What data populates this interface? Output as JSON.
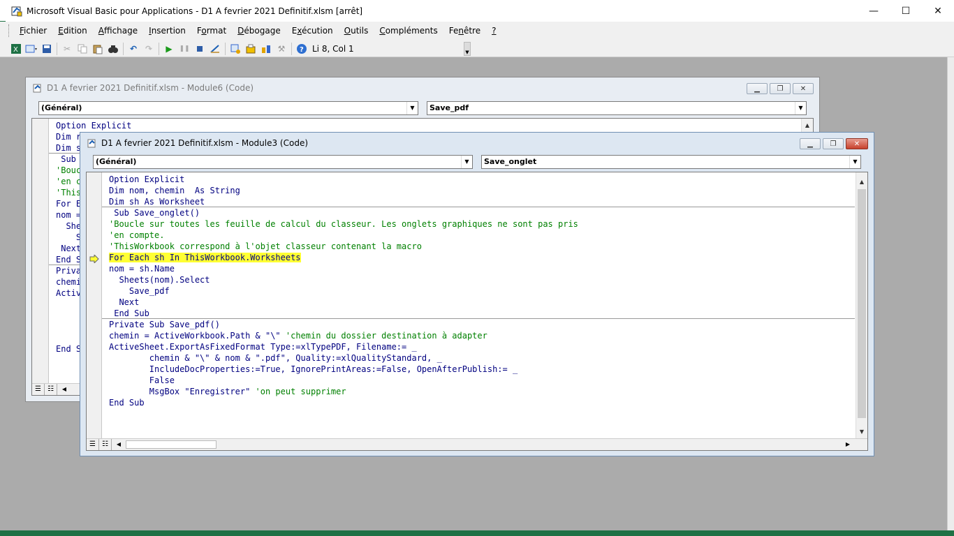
{
  "app": {
    "title": "Microsoft Visual Basic pour Applications - D1 A fevrier 2021 Definitif.xlsm [arrêt]",
    "controls": {
      "minimize": "—",
      "maximize": "☐",
      "close": "✕"
    }
  },
  "menu": [
    {
      "label": "Fichier",
      "ul": "F",
      "rest": "ichier"
    },
    {
      "label": "Edition",
      "ul": "E",
      "rest": "dition"
    },
    {
      "label": "Affichage",
      "ul": "A",
      "rest": "ffichage"
    },
    {
      "label": "Insertion",
      "ul": "I",
      "rest": "nsertion"
    },
    {
      "label": "Format",
      "ul": "o",
      "pre": "F",
      "rest": "rmat"
    },
    {
      "label": "Débogage",
      "ul": "D",
      "rest": "ébogage"
    },
    {
      "label": "Exécution",
      "ul": "x",
      "pre": "E",
      "rest": "écution"
    },
    {
      "label": "Outils",
      "ul": "O",
      "rest": "utils"
    },
    {
      "label": "Compléments",
      "ul": "C",
      "rest": "ompléments"
    },
    {
      "label": "Fenêtre",
      "ul": "n",
      "pre": "Fe",
      "rest": "être"
    },
    {
      "label": "?",
      "ul": "?",
      "rest": ""
    }
  ],
  "toolbar": {
    "cursor_position": "Li 8, Col 1"
  },
  "window_back": {
    "title": "D1 A fevrier 2021 Definitif.xlsm - Module6 (Code)",
    "object_combo": "(Général)",
    "proc_combo": "Save_pdf",
    "lines": [
      {
        "t": "Option Explicit",
        "c": ""
      },
      {
        "t": "Dim r",
        "c": ""
      },
      {
        "t": "Dim s",
        "c": ""
      },
      {
        "t": " Sub ",
        "c": ""
      },
      {
        "t": "",
        "c": "'Bouc"
      },
      {
        "t": "",
        "c": "'en c"
      },
      {
        "t": "",
        "c": "'This"
      },
      {
        "t": "For E",
        "c": ""
      },
      {
        "t": "nom =",
        "c": ""
      },
      {
        "t": "  She",
        "c": ""
      },
      {
        "t": "    S",
        "c": ""
      },
      {
        "t": " Next",
        "c": ""
      },
      {
        "t": "End S",
        "c": ""
      },
      {
        "t": "Priva",
        "c": ""
      },
      {
        "t": "chemi",
        "c": ""
      },
      {
        "t": "Activ",
        "c": ""
      },
      {
        "t": "",
        "c": ""
      },
      {
        "t": "",
        "c": ""
      },
      {
        "t": "",
        "c": ""
      },
      {
        "t": "",
        "c": ""
      },
      {
        "t": "End S",
        "c": ""
      }
    ]
  },
  "window_front": {
    "title": "D1 A fevrier 2021 Definitif.xlsm - Module3 (Code)",
    "object_combo": "(Général)",
    "proc_combo": "Save_onglet",
    "lines": [
      {
        "t": "Option Explicit",
        "c": ""
      },
      {
        "t": "Dim nom, chemin  As String",
        "c": ""
      },
      {
        "t": "Dim sh As Worksheet",
        "c": ""
      },
      {
        "t": " Sub Save_onglet()",
        "c": ""
      },
      {
        "t": "",
        "c": "'Boucle sur toutes les feuille de calcul du classeur. Les onglets graphiques ne sont pas pris"
      },
      {
        "t": "",
        "c": "'en compte."
      },
      {
        "t": "",
        "c": "'ThisWorkbook correspond à l'objet classeur contenant la macro"
      },
      {
        "t": "For Each sh In ThisWorkbook.Worksheets",
        "c": "",
        "hl": true
      },
      {
        "t": "nom = sh.Name",
        "c": ""
      },
      {
        "t": "  Sheets(nom).Select",
        "c": ""
      },
      {
        "t": "    Save_pdf",
        "c": ""
      },
      {
        "t": "  Next",
        "c": ""
      },
      {
        "t": " End Sub",
        "c": ""
      },
      {
        "t": "Private Sub Save_pdf()",
        "c": ""
      },
      {
        "t": "chemin = ActiveWorkbook.Path & \"\\\" ",
        "c": "'chemin du dossier destination à adapter"
      },
      {
        "t": "ActiveSheet.ExportAsFixedFormat Type:=xlTypePDF, Filename:= _",
        "c": ""
      },
      {
        "t": "        chemin & \"\\\" & nom & \".pdf\", Quality:=xlQualityStandard, _",
        "c": ""
      },
      {
        "t": "        IncludeDocProperties:=True, IgnorePrintAreas:=False, OpenAfterPublish:= _",
        "c": ""
      },
      {
        "t": "        False",
        "c": ""
      },
      {
        "t": "        MsgBox \"Enregistrer\" ",
        "c": "'on peut supprimer"
      },
      {
        "t": "End Sub",
        "c": ""
      }
    ]
  }
}
